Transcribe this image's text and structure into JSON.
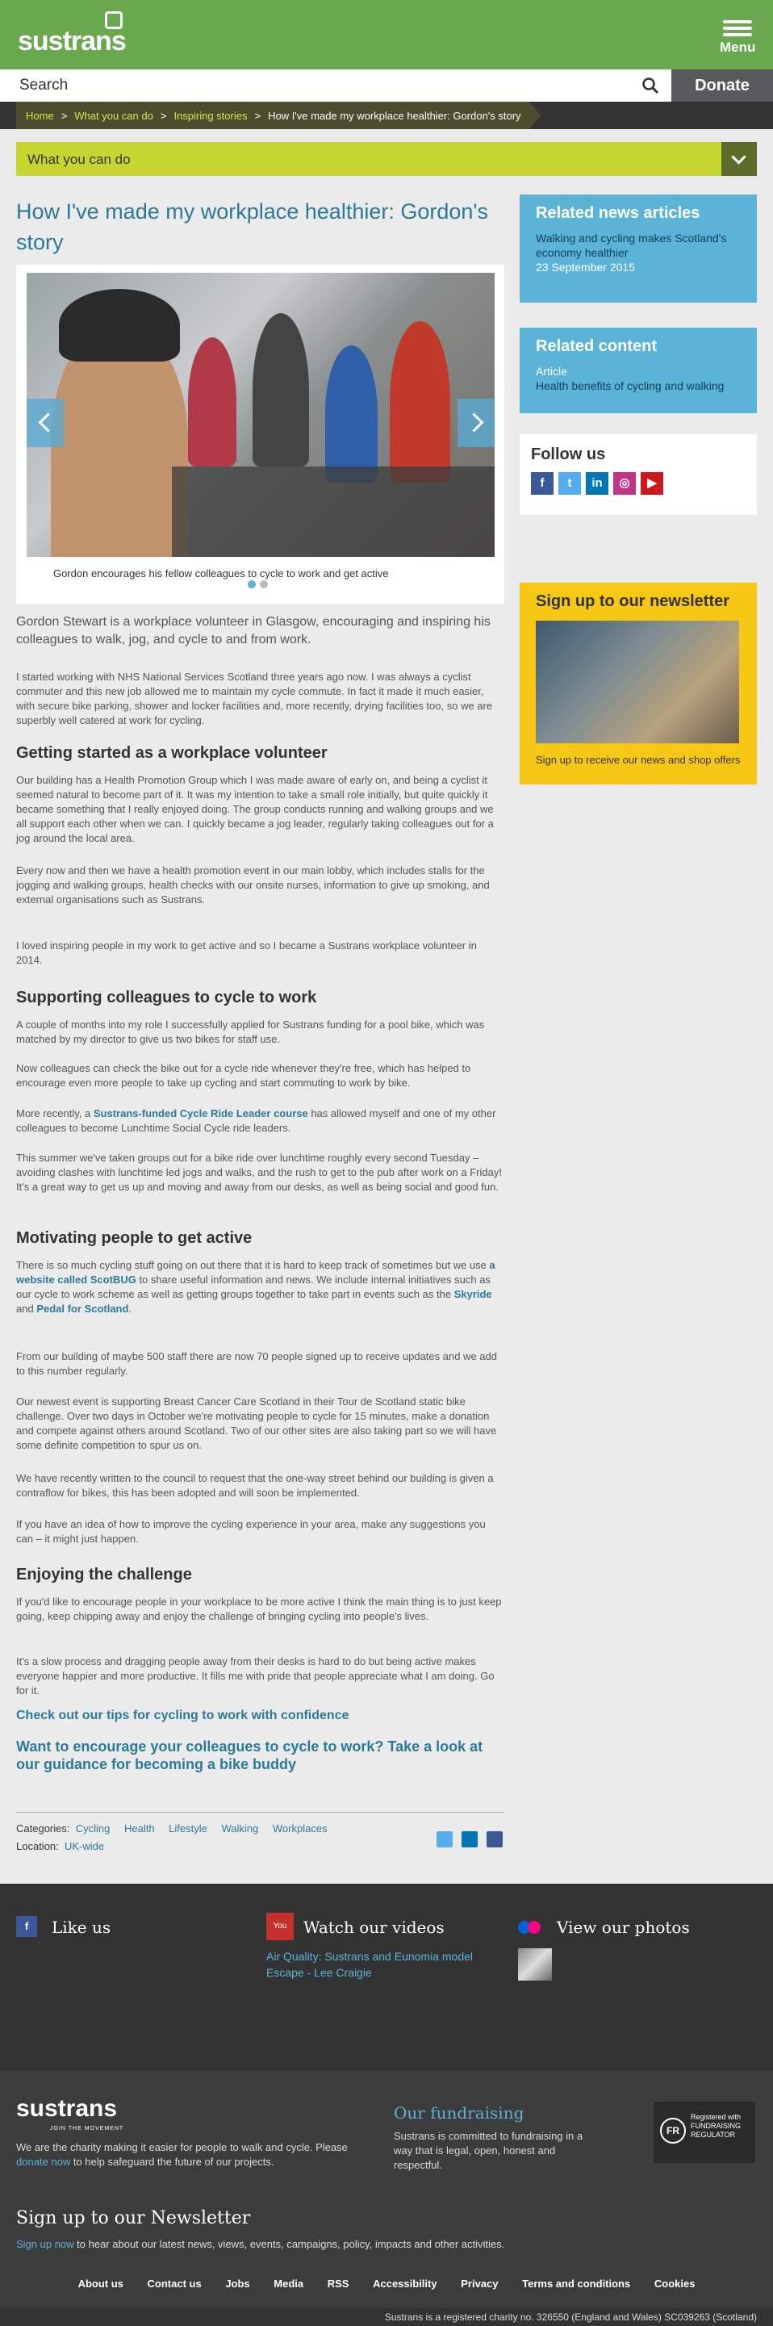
{
  "header": {
    "logo": "sustrans",
    "menu_label": "Menu",
    "search_placeholder": "Search",
    "donate_label": "Donate"
  },
  "breadcrumb": {
    "items": [
      "Home",
      "What you can do",
      "Inspiring stories"
    ],
    "current": "How I've made my workplace healthier: Gordon's story"
  },
  "section_nav": {
    "label": "What you can do"
  },
  "article": {
    "title": "How I've made my workplace healthier: Gordon's story",
    "caption": "Gordon encourages his fellow colleagues to cycle to work and get active",
    "lead": "Gordon Stewart is a workplace volunteer in Glasgow, encouraging and inspiring his colleagues to walk, jog, and cycle to and from work.",
    "p1": "I started working with NHS National Services Scotland three years ago now. I was always a cyclist commuter and this new job allowed me to maintain my cycle commute. In fact it made it much easier, with secure bike parking, shower and locker facilities and, more recently, drying facilities too, so we are superbly well catered at work for cycling.",
    "h_getting_started": "Getting started as a workplace volunteer",
    "p2": "Our building has a Health Promotion Group which I was made aware of early on, and being a cyclist it seemed natural to become part of it. It was my intention to take a small role initially, but quite quickly it became something that I really enjoyed doing. The group conducts running and walking groups and we all support each other when we can. I quickly became a jog leader, regularly taking colleagues out for a jog around the local area.",
    "p3": "Every now and then we have a health promotion event in our main lobby, which includes stalls for the jogging and walking groups, health checks with our onsite nurses, information to give up smoking, and external organisations such as Sustrans.",
    "p4": "I loved inspiring people in my work to get active and so I became a Sustrans workplace volunteer in 2014.",
    "h_supporting": "Supporting colleagues to cycle to work",
    "p5": "A couple of months into my role I successfully applied for Sustrans funding for a pool bike, which was matched by my director to give us two bikes for staff use.",
    "p6": "Now colleagues can check the bike out for a cycle ride whenever they're free, which has helped to encourage even more people to take up cycling and start commuting to work by bike.",
    "p7_before": "More recently, a ",
    "p7_link": "Sustrans-funded Cycle Ride Leader course",
    "p7_after": " has allowed myself and one of my other colleagues to become Lunchtime Social Cycle ride leaders.",
    "p8": "This summer we've taken groups out for a bike ride over lunchtime roughly every second Tuesday – avoiding clashes with lunchtime led jogs and walks, and the rush to get to the pub after work on a Friday! It's a great way to get us up and moving and away from our desks, as well as being social and good fun.",
    "h_motivating": "Motivating people to get active",
    "p9_a": "There is so much cycling stuff going on out there that it is hard to keep track of sometimes but we use ",
    "p9_link1": "a website called ScotBUG",
    "p9_b": " to share useful information and news. We include internal initiatives such as our cycle to work scheme as well as getting groups together to take part in events such as the ",
    "p9_link2": "Skyride",
    "p9_c": " and ",
    "p9_link3": "Pedal for Scotland",
    "p9_d": ".",
    "p10": "From our building of maybe 500 staff there are now 70 people signed up to receive updates and we add to this number regularly.",
    "p11": "Our newest event is supporting Breast Cancer Care Scotland in their Tour de Scotland static bike challenge. Over two days in October we're motivating people to cycle for 15 minutes, make a donation and compete against others around Scotland. Two of our other sites are also taking part so we will have some definite competition to spur us on.",
    "p12": "We have recently written to the council to request that the one-way street behind our building is given a contraflow for bikes, this has been adopted and will soon be implemented.",
    "p13": "If you have an idea of how to improve the cycling experience in your area, make any suggestions you can – it might just happen.",
    "h_enjoying": "Enjoying the challenge",
    "p14": "If you'd like to encourage people in your workplace to be more active I think the main thing is to just keep going, keep chipping away and enjoy the challenge of bringing cycling into people's lives.",
    "p15": "It's a slow process and dragging people away from their desks is hard to do but being active makes everyone happier and more productive. It fills me with pride that people appreciate what I am doing. Go for it.",
    "cta1": "Check out our tips for cycling to work with confidence",
    "cta2": "Want to encourage your colleagues to cycle to work? Take a look at our guidance for becoming a bike buddy",
    "categories_label": "Categories:",
    "categories": [
      "Cycling",
      "Health",
      "Lifestyle",
      "Walking",
      "Workplaces"
    ],
    "location_label": "Location:",
    "location": "UK-wide"
  },
  "sidebar": {
    "related_news_title": "Related news articles",
    "related_news_link": "Walking and cycling makes Scotland's economy healthier",
    "related_news_date": "23 September 2015",
    "related_content_title": "Related content",
    "related_content_type": "Article",
    "related_content_link": "Health benefits of cycling and walking",
    "follow_title": "Follow us",
    "newsletter_title": "Sign up to our newsletter",
    "newsletter_text": "Sign up to receive our news and shop offers"
  },
  "footer": {
    "like_us": "Like us",
    "watch_videos": "Watch our videos",
    "video_link": "Air Quality: Sustrans and Eunomia model Escape - Lee Craigie",
    "view_photos": "View our photos",
    "logo": "sustrans",
    "tagline": "JOIN THE MOVEMENT",
    "charity_text_a": "We are the charity making it easier for people to walk and cycle. Please ",
    "charity_link": "donate now",
    "charity_text_b": " to help safeguard the future of our projects.",
    "fundraising_title": "Our fundraising",
    "fundraising_text": "Sustrans is committed to fundraising in a way that is legal, open, honest and respectful.",
    "regulator_badge": "Registered with FUNDRAISING REGULATOR",
    "newsletter_title": "Sign up to our Newsletter",
    "newsletter_link": "Sign up now",
    "newsletter_text": " to hear about our latest news, views, events, campaigns, policy, impacts and other activities.",
    "links": [
      "About us",
      "Contact us",
      "Jobs",
      "Media",
      "RSS",
      "Accessibility",
      "Privacy",
      "Terms and conditions",
      "Cookies"
    ],
    "charity_no": "Sustrans is a registered charity no. 326550 (England and Wales) SC039263 (Scotland)"
  },
  "colors": {
    "green": "#6aa84f",
    "lime": "#c7d530",
    "blue": "#5bb4d8",
    "yellow": "#f6c815",
    "link": "#2b7a99"
  }
}
